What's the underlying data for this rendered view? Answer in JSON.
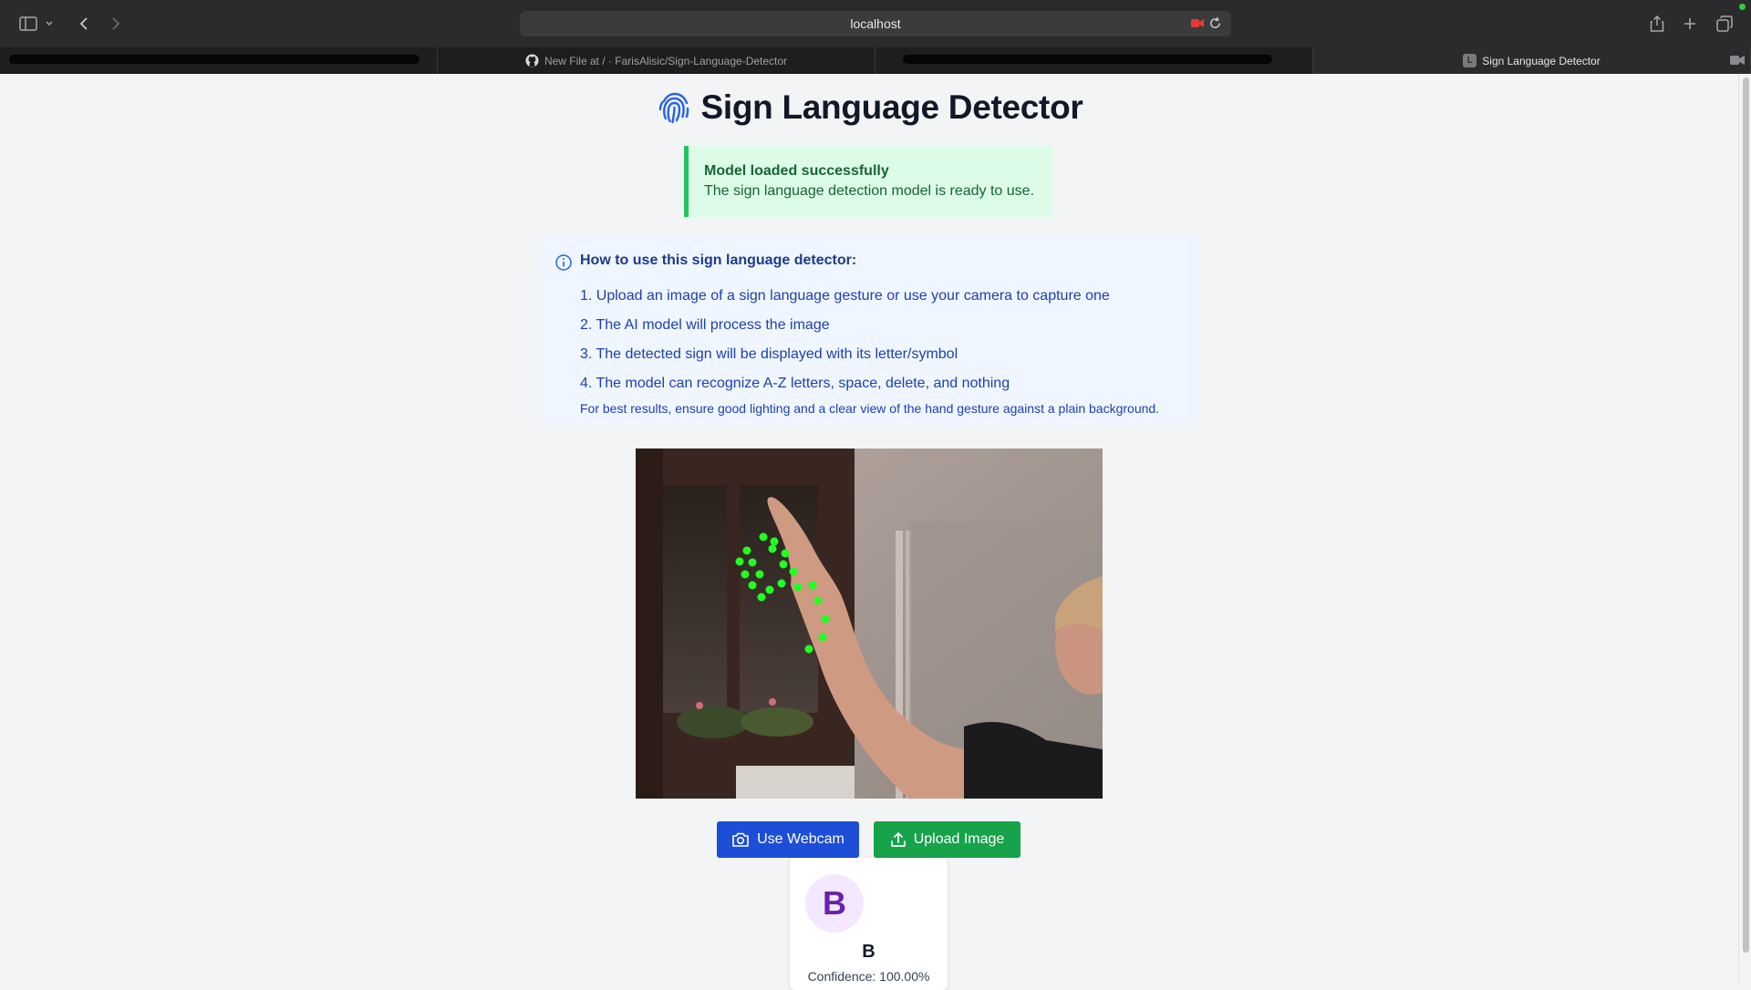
{
  "browser": {
    "url": "localhost",
    "tabs": [
      {
        "label": ""
      },
      {
        "label": "New File at / · FarisAlisic/Sign-Language-Detector"
      },
      {
        "label": ""
      },
      {
        "label": "Sign Language Detector",
        "favicon_letter": "L"
      }
    ]
  },
  "page": {
    "title": "Sign Language Detector",
    "alert": {
      "title": "Model loaded successfully",
      "message": "The sign language detection model is ready to use."
    },
    "instructions": {
      "title": "How to use this sign language detector:",
      "steps": [
        "1. Upload an image of a sign language gesture or use your camera to capture one",
        "2. The AI model will process the image",
        "3. The detected sign will be displayed with its letter/symbol",
        "4. The model can recognize A-Z letters, space, delete, and nothing"
      ],
      "note": "For best results, ensure good lighting and a clear view of the hand gesture against a plain background."
    },
    "buttons": {
      "webcam": "Use Webcam",
      "upload": "Upload Image"
    },
    "result": {
      "badge_letter": "B",
      "letter": "B",
      "confidence": "Confidence: 100.00%"
    }
  },
  "colors": {
    "primary": "#1d4ed8",
    "success": "#16a34a",
    "landmark": "#22ff22"
  }
}
